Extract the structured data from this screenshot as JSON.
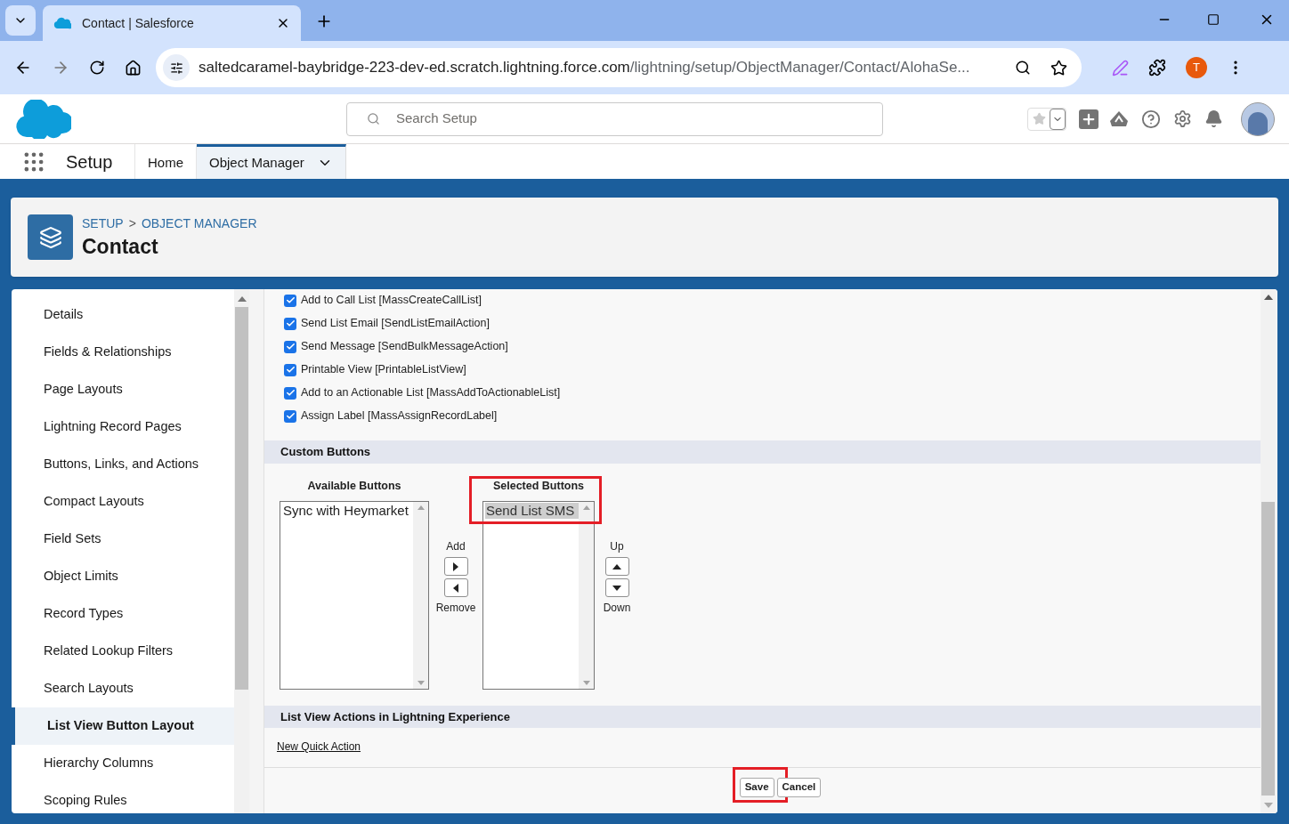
{
  "browser": {
    "tab_title": "Contact | Salesforce",
    "url_host": "saltedcaramel-baybridge-223-dev-ed.scratch.lightning.force.com",
    "url_path": "/lightning/setup/ObjectManager/Contact/AlohaSe...",
    "profile_initial": "T"
  },
  "header": {
    "search_placeholder": "Search Setup"
  },
  "nav": {
    "app_name": "Setup",
    "tabs": [
      {
        "label": "Home",
        "selected": false
      },
      {
        "label": "Object Manager",
        "selected": true
      }
    ]
  },
  "page_header": {
    "breadcrumbs": [
      "SETUP",
      "OBJECT MANAGER"
    ],
    "separator": ">",
    "title": "Contact"
  },
  "sidebar": {
    "items": [
      {
        "label": "Details",
        "selected": false
      },
      {
        "label": "Fields & Relationships",
        "selected": false
      },
      {
        "label": "Page Layouts",
        "selected": false
      },
      {
        "label": "Lightning Record Pages",
        "selected": false
      },
      {
        "label": "Buttons, Links, and Actions",
        "selected": false
      },
      {
        "label": "Compact Layouts",
        "selected": false
      },
      {
        "label": "Field Sets",
        "selected": false
      },
      {
        "label": "Object Limits",
        "selected": false
      },
      {
        "label": "Record Types",
        "selected": false
      },
      {
        "label": "Related Lookup Filters",
        "selected": false
      },
      {
        "label": "Search Layouts",
        "selected": false
      },
      {
        "label": "List View Button Layout",
        "selected": true
      },
      {
        "label": "Hierarchy Columns",
        "selected": false
      },
      {
        "label": "Scoping Rules",
        "selected": false
      }
    ]
  },
  "standard_buttons": [
    {
      "label": "Add to Call List [MassCreateCallList]",
      "checked": true
    },
    {
      "label": "Send List Email [SendListEmailAction]",
      "checked": true
    },
    {
      "label": "Send Message [SendBulkMessageAction]",
      "checked": true
    },
    {
      "label": "Printable View [PrintableListView]",
      "checked": true
    },
    {
      "label": "Add to an Actionable List [MassAddToActionableList]",
      "checked": true
    },
    {
      "label": "Assign Label [MassAssignRecordLabel]",
      "checked": true
    }
  ],
  "custom_buttons": {
    "heading": "Custom Buttons",
    "available": {
      "label": "Available Buttons",
      "options": [
        {
          "label": "Sync with Heymarket",
          "selected": false
        }
      ]
    },
    "add_label": "Add",
    "remove_label": "Remove",
    "selected": {
      "label": "Selected Buttons",
      "highlighted": true,
      "options": [
        {
          "label": "Send List SMS",
          "selected": true
        }
      ]
    },
    "up_label": "Up",
    "down_label": "Down"
  },
  "list_view_actions": {
    "heading": "List View Actions in Lightning Experience",
    "link": "New Quick Action"
  },
  "footer_buttons": [
    {
      "label": "Save",
      "highlighted": true
    },
    {
      "label": "Cancel",
      "highlighted": false
    }
  ]
}
